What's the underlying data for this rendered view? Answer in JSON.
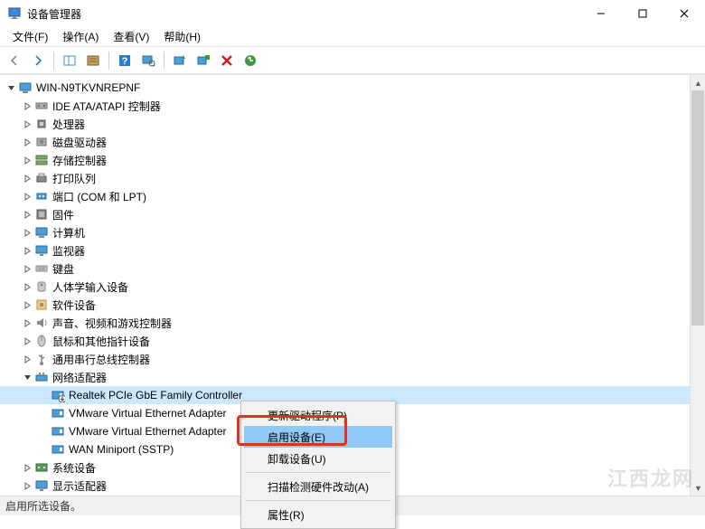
{
  "window": {
    "title": "设备管理器",
    "min_tip": "最小化",
    "max_tip": "最大化",
    "close_tip": "关闭"
  },
  "menu": {
    "file": "文件(F)",
    "action": "操作(A)",
    "view": "查看(V)",
    "help": "帮助(H)"
  },
  "toolbar_icons": {
    "back": "back-icon",
    "forward": "forward-icon",
    "show_hide": "show-hide-icon",
    "console": "console-icon",
    "help": "help-icon",
    "scan": "scan-icon",
    "monitor": "monitor-icon",
    "enable": "enable-icon",
    "disable": "disable-icon",
    "update": "update-icon"
  },
  "tree": {
    "root": "WIN-N9TKVNREPNF",
    "categories": [
      {
        "label": "IDE ATA/ATAPI 控制器",
        "icon": "ide"
      },
      {
        "label": "处理器",
        "icon": "cpu"
      },
      {
        "label": "磁盘驱动器",
        "icon": "disk"
      },
      {
        "label": "存储控制器",
        "icon": "storage"
      },
      {
        "label": "打印队列",
        "icon": "printer"
      },
      {
        "label": "端口 (COM 和 LPT)",
        "icon": "port"
      },
      {
        "label": "固件",
        "icon": "firmware"
      },
      {
        "label": "计算机",
        "icon": "computer"
      },
      {
        "label": "监视器",
        "icon": "monitor"
      },
      {
        "label": "键盘",
        "icon": "keyboard"
      },
      {
        "label": "人体学输入设备",
        "icon": "hid"
      },
      {
        "label": "软件设备",
        "icon": "software"
      },
      {
        "label": "声音、视频和游戏控制器",
        "icon": "audio"
      },
      {
        "label": "鼠标和其他指针设备",
        "icon": "mouse"
      },
      {
        "label": "通用串行总线控制器",
        "icon": "usb"
      }
    ],
    "network": {
      "label": "网络适配器",
      "children": [
        {
          "label": "Realtek PCIe GbE Family Controller",
          "selected": true,
          "disabled": true
        },
        {
          "label": "VMware Virtual Ethernet Adapter"
        },
        {
          "label": "VMware Virtual Ethernet Adapter"
        },
        {
          "label": "WAN Miniport (SSTP)"
        }
      ]
    },
    "after": [
      {
        "label": "系统设备",
        "icon": "system"
      },
      {
        "label": "显示适配器",
        "icon": "display"
      }
    ]
  },
  "context_menu": {
    "items": [
      {
        "label": "更新驱动程序(P)",
        "key": "update"
      },
      {
        "label": "启用设备(E)",
        "key": "enable",
        "highlighted": true
      },
      {
        "label": "卸载设备(U)",
        "key": "uninstall"
      },
      {
        "sep": true
      },
      {
        "label": "扫描检测硬件改动(A)",
        "key": "scan"
      },
      {
        "sep": true
      },
      {
        "label": "属性(R)",
        "key": "properties"
      }
    ]
  },
  "status": "启用所选设备。",
  "watermark": "江西龙网"
}
